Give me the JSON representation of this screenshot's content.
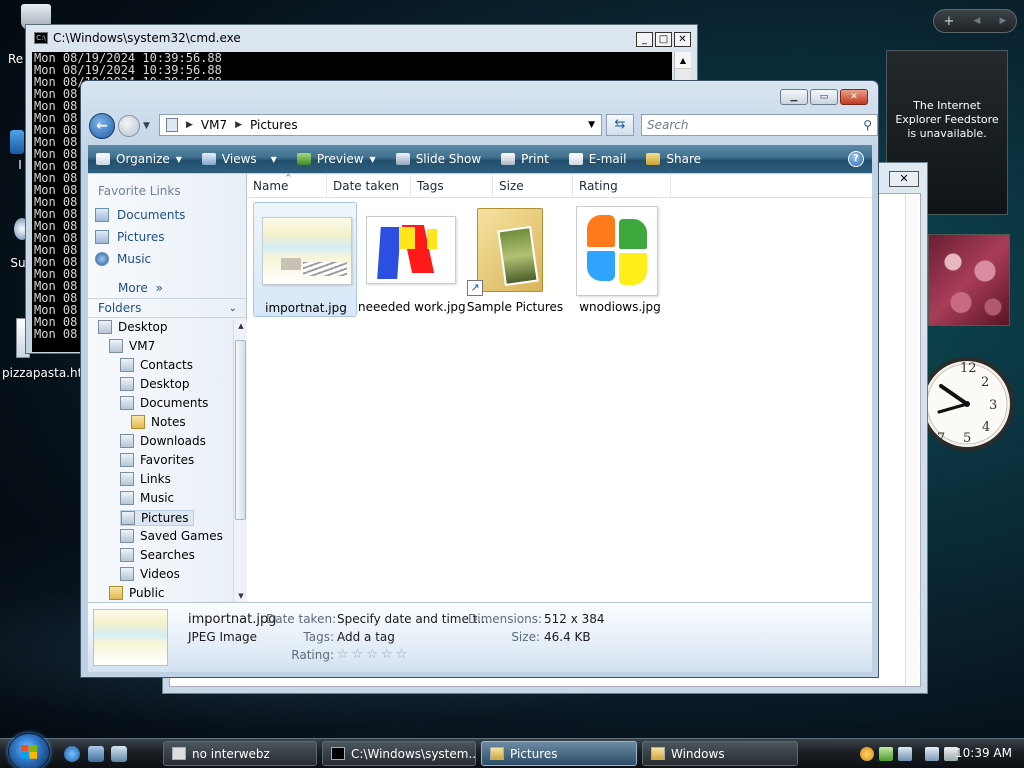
{
  "desktop": {
    "icons": [
      {
        "label": "Re"
      },
      {
        "label": "I"
      },
      {
        "label": "Su"
      },
      {
        "label": "pizzapasta.hta"
      }
    ]
  },
  "sidebar": {
    "feed_message": "The Internet Explorer Feedstore is unavailable.",
    "controls": [
      "+",
      "◀",
      "▶"
    ]
  },
  "cmd": {
    "title": "C:\\Windows\\system32\\cmd.exe",
    "lines": [
      "Mon 08/19/2024 10:39:56.88",
      "Mon 08/19/2024 10:39:56.88",
      "Mon 08/19/2024 10:39:56.88",
      "Mon 08",
      "Mon 08",
      "Mon 08",
      "Mon 08",
      "Mon 08",
      "Mon 08",
      "Mon 08",
      "Mon 08",
      "Mon 08",
      "Mon 08",
      "Mon 08",
      "Mon 08",
      "Mon 08",
      "Mon 08",
      "Mon 08",
      "Mon 08",
      "Mon 08",
      "Mon 08",
      "Mon 08",
      "Mon 08",
      "Mon 08"
    ]
  },
  "explorer": {
    "breadcrumb": [
      "VM7",
      "Pictures"
    ],
    "search_placeholder": "Search",
    "toolbar": [
      {
        "label": "Organize",
        "has_arrow": true
      },
      {
        "label": "Views",
        "has_arrow": true
      },
      {
        "label": "Preview",
        "has_arrow": true
      },
      {
        "label": "Slide Show"
      },
      {
        "label": "Print"
      },
      {
        "label": "E-mail"
      },
      {
        "label": "Share"
      }
    ],
    "favorite_links_header": "Favorite Links",
    "favorite_links": [
      "Documents",
      "Pictures",
      "Music"
    ],
    "more_label": "More",
    "folders_header": "Folders",
    "tree": [
      {
        "label": "Desktop",
        "indent": 0
      },
      {
        "label": "VM7",
        "indent": 1
      },
      {
        "label": "Contacts",
        "indent": 2
      },
      {
        "label": "Desktop",
        "indent": 2
      },
      {
        "label": "Documents",
        "indent": 2
      },
      {
        "label": "Notes",
        "indent": 3
      },
      {
        "label": "Downloads",
        "indent": 2
      },
      {
        "label": "Favorites",
        "indent": 2
      },
      {
        "label": "Links",
        "indent": 2
      },
      {
        "label": "Music",
        "indent": 2
      },
      {
        "label": "Pictures",
        "indent": 2,
        "selected": true
      },
      {
        "label": "Saved Games",
        "indent": 2
      },
      {
        "label": "Searches",
        "indent": 2
      },
      {
        "label": "Videos",
        "indent": 2
      },
      {
        "label": "Public",
        "indent": 1
      }
    ],
    "columns": [
      "Name",
      "Date taken",
      "Tags",
      "Size",
      "Rating"
    ],
    "files": [
      {
        "name": "importnat.jpg",
        "selected": true
      },
      {
        "name": "neeeded work.jpg"
      },
      {
        "name": "Sample Pictures"
      },
      {
        "name": "wnodiows.jpg"
      }
    ],
    "details": {
      "filename": "importnat.jpg",
      "type": "JPEG Image",
      "date_taken_label": "Date taken:",
      "date_taken_value": "Specify date and time t...",
      "tags_label": "Tags:",
      "tags_value": "Add a tag",
      "rating_label": "Rating:",
      "rating": 0,
      "dimensions_label": "Dimensions:",
      "dimensions_value": "512 x 384",
      "size_label": "Size:",
      "size_value": "46.4 KB"
    }
  },
  "taskbar": {
    "tasks": [
      {
        "label": "no interwebz"
      },
      {
        "label": "C:\\Windows\\system..."
      },
      {
        "label": "Pictures",
        "active": true
      },
      {
        "label": "Windows"
      }
    ],
    "clock": "10:39 AM"
  }
}
